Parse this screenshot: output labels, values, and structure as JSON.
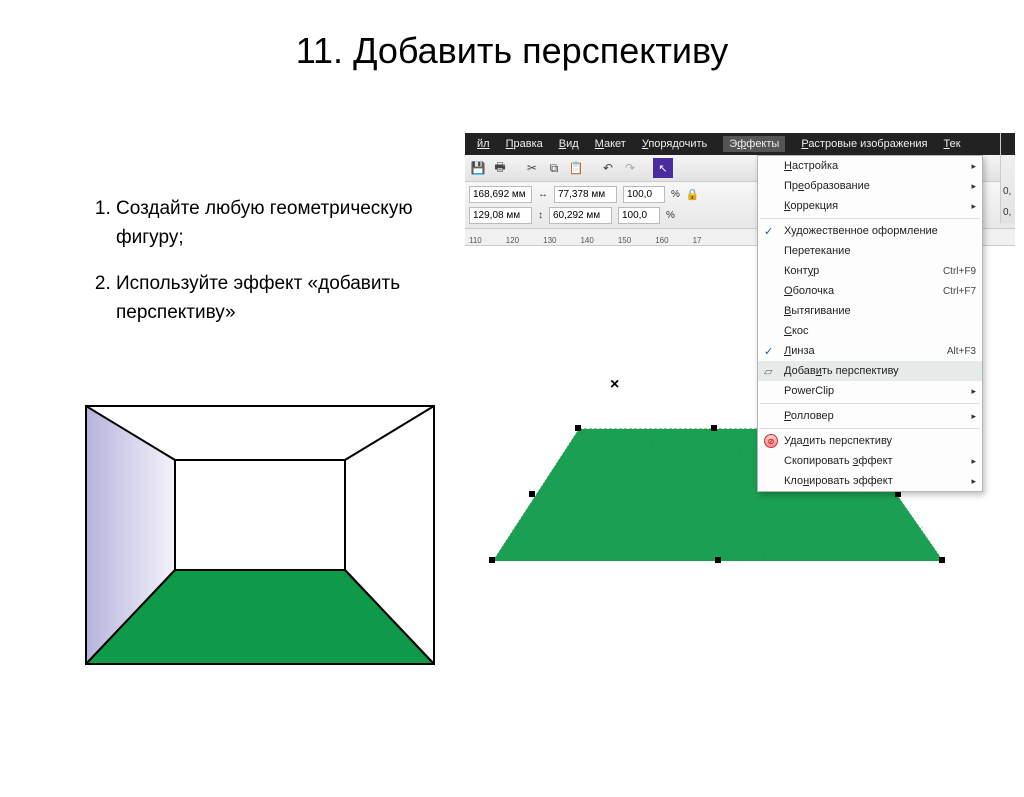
{
  "title": "11. Добавить перспективу",
  "instructions": {
    "items": [
      "Создайте любую геометрическую фигуру;",
      "Используйте эффект «добавить перспективу»"
    ]
  },
  "menubar": {
    "items": [
      "йл",
      "Правка",
      "Вид",
      "Макет",
      "Упорядочить",
      "Эффекты",
      "Растровые изображения",
      "Тек"
    ]
  },
  "propbar": {
    "x": "168,692 мм",
    "y": "129,08 мм",
    "w_label": "↔",
    "h_label": "↕",
    "w": "77,378 мм",
    "h": "60,292 мм",
    "scale1": "100,0",
    "scale2": "100,0",
    "pct": "%",
    "right1": "0,",
    "right2": "0,"
  },
  "ruler": {
    "ticks": [
      "110",
      "120",
      "130",
      "140",
      "150",
      "160",
      "17"
    ]
  },
  "dropdown": {
    "items": [
      {
        "label": "Настройка",
        "arrow": true
      },
      {
        "label": "Преобразование",
        "arrow": true
      },
      {
        "label": "Коррекция",
        "arrow": true
      },
      {
        "sep": true
      },
      {
        "label": "Художественное оформление",
        "check": true
      },
      {
        "label": "Перетекание"
      },
      {
        "label": "Контур",
        "shortcut": "Ctrl+F9"
      },
      {
        "label": "Оболочка",
        "shortcut": "Ctrl+F7"
      },
      {
        "label": "Вытягивание"
      },
      {
        "label": "Скос"
      },
      {
        "label": "Линза",
        "shortcut": "Alt+F3",
        "check": true
      },
      {
        "label": "Добавить перспективу",
        "highlight": true,
        "icon": "▱"
      },
      {
        "label": "PowerClip",
        "arrow": true
      },
      {
        "sep": true
      },
      {
        "label": "Ролловер",
        "arrow": true
      },
      {
        "sep": true
      },
      {
        "label": "Удалить перспективу",
        "redicon": true
      },
      {
        "label": "Скопировать эффект",
        "arrow": true
      },
      {
        "label": "Клонировать эффект",
        "arrow": true
      }
    ]
  },
  "canvas": {
    "cross": "×"
  },
  "colors": {
    "floor": "#0f9a4a",
    "wall": "#c7c5e6"
  }
}
